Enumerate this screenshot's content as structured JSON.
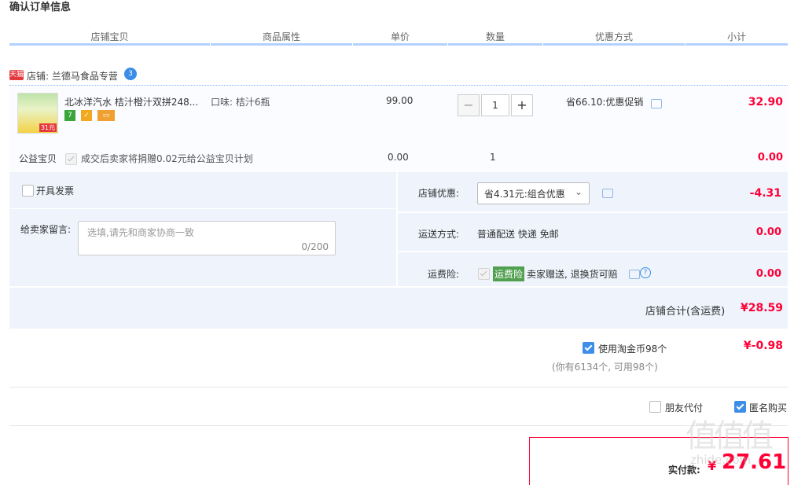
{
  "page_title": "确认订单信息",
  "columns": [
    "店铺宝贝",
    "商品属性",
    "单价",
    "数量",
    "优惠方式",
    "小计"
  ],
  "shop": {
    "badge": "天猫",
    "label": "店铺: 兰德马食品专营",
    "wangwang": "3"
  },
  "item": {
    "name": "北冰洋汽水 桔汁橙汁双拼248...",
    "attr": "口味: 桔汁6瓶",
    "price": "99.00",
    "qty": "1",
    "minus": "−",
    "plus": "+",
    "promo": "省66.10:优惠促销",
    "subtotal": "32.90",
    "thumb_badge": "31元"
  },
  "charity": {
    "label": "公益宝贝",
    "text": "成交后卖家将捐赠0.02元给公益宝贝计划",
    "price": "0.00",
    "qty": "1",
    "subtotal": "0.00"
  },
  "invoice_label": "开具发票",
  "message": {
    "label": "给卖家留言:",
    "placeholder": "选填,请先和商家协商一致",
    "counter": "0/200"
  },
  "shop_discount": {
    "label": "店铺优惠:",
    "value": "省4.31元:组合优惠",
    "amount": "-4.31"
  },
  "shipping": {
    "label": "运送方式:",
    "value": "普通配送 快递 免邮",
    "amount": "0.00"
  },
  "insurance": {
    "label": "运费险:",
    "tag": "运费险",
    "text": "卖家赠送, 退换货可赔",
    "amount": "0.00"
  },
  "shop_total": {
    "label": "店铺合计(含运费)",
    "amount": "¥28.59"
  },
  "coins": {
    "label": "使用淘金币98个",
    "note": "(你有6134个, 可用98个)",
    "amount": "¥-0.98"
  },
  "friend_pay": "朋友代付",
  "anonymous": "匿名购买",
  "pay": {
    "label": "实付款:",
    "currency": "¥",
    "amount": "27.61"
  },
  "watermark": {
    "glyphs": "值值值",
    "url": "zhide.com"
  },
  "colors": {
    "accent_red": "#ff0036",
    "header_line": "#b2d1ff",
    "panel_bg": "#eef3fc",
    "checkbox_blue": "#3d8ee8"
  }
}
